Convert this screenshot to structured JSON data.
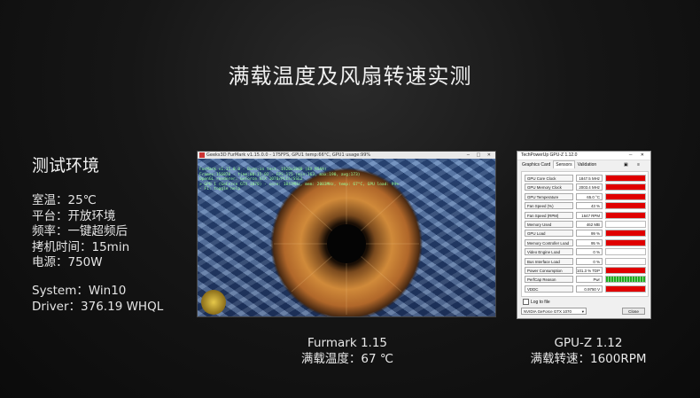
{
  "title": "满载温度及风扇转速实测",
  "env": {
    "heading": "测试环境",
    "lines": [
      "室温：25℃",
      "平台：开放环境",
      "频率：一键超频后",
      "拷机时间：15min",
      "电源：750W"
    ],
    "system": "System：Win10",
    "driver": "Driver：376.19 WHQL"
  },
  "furmark": {
    "window_title": "Geeks3D FurMark v1.15.0.0 - 175FPS, GPU1 temp:66°C, GPU1 usage:99%",
    "hud": [
      "FurMark v1.15.0.0 - Burn-in test, 1920x1080 (8X MSAA)",
      "Frames:156870 - time:00:15:02 - FPS:175 (min:163, max:190, avg:173)",
      "OpenGL renderer: GeForce GTX 1070/PCIe/SSE2",
      "> GPU 1 (GeForce GTX 1070) - core: 1847MHz, mem: 2003MHz, temp: 67°C, GPU load: 99%",
      "- F1: toggle help"
    ],
    "caption_line1": "Furmark 1.15",
    "caption_line2": "满载温度：67 ℃"
  },
  "gpuz": {
    "window_title": "TechPowerUp GPU-Z 1.12.0",
    "tabs": [
      "Graphics Card",
      "Sensors",
      "Validation"
    ],
    "active_tab": "Sensors",
    "sensors": [
      {
        "label": "GPU Core Clock",
        "value": "1847.5 MHz",
        "fill": 1.0,
        "pattern": "solid"
      },
      {
        "label": "GPU Memory Clock",
        "value": "2003.4 MHz",
        "fill": 1.0,
        "pattern": "solid"
      },
      {
        "label": "GPU Temperature",
        "value": "65.0 °C",
        "fill": 1.0,
        "pattern": "solid"
      },
      {
        "label": "Fan Speed (%)",
        "value": "43 %",
        "fill": 1.0,
        "pattern": "solid"
      },
      {
        "label": "Fan Speed (RPM)",
        "value": "1647 RPM",
        "fill": 1.0,
        "pattern": "solid"
      },
      {
        "label": "Memory Used",
        "value": "462 MB",
        "fill": 0.0,
        "pattern": "solid"
      },
      {
        "label": "GPU Load",
        "value": "99 %",
        "fill": 1.0,
        "pattern": "solid"
      },
      {
        "label": "Memory Controller Load",
        "value": "95 %",
        "fill": 1.0,
        "pattern": "solid"
      },
      {
        "label": "Video Engine Load",
        "value": "0 %",
        "fill": 0.0,
        "pattern": "solid"
      },
      {
        "label": "Bus Interface Load",
        "value": "0 %",
        "fill": 0.0,
        "pattern": "solid"
      },
      {
        "label": "Power Consumption",
        "value": "101.3 % TDP",
        "fill": 1.0,
        "pattern": "solid"
      },
      {
        "label": "PerfCap Reason",
        "value": "Pwr",
        "fill": 1.0,
        "pattern": "stripes"
      },
      {
        "label": "VDDC",
        "value": "0.9750 V",
        "fill": 1.0,
        "pattern": "solid"
      }
    ],
    "log_label": "Log to file",
    "gpu_select": "NVIDIA GeForce GTX 1070",
    "close_label": "Close",
    "caption_line1": "GPU-Z 1.12",
    "caption_line2": "满载转速：1600RPM"
  },
  "colors": {
    "bar_red": "#e00000",
    "bar_green": "#1faa1f",
    "eye_amber": "#c8782a"
  }
}
